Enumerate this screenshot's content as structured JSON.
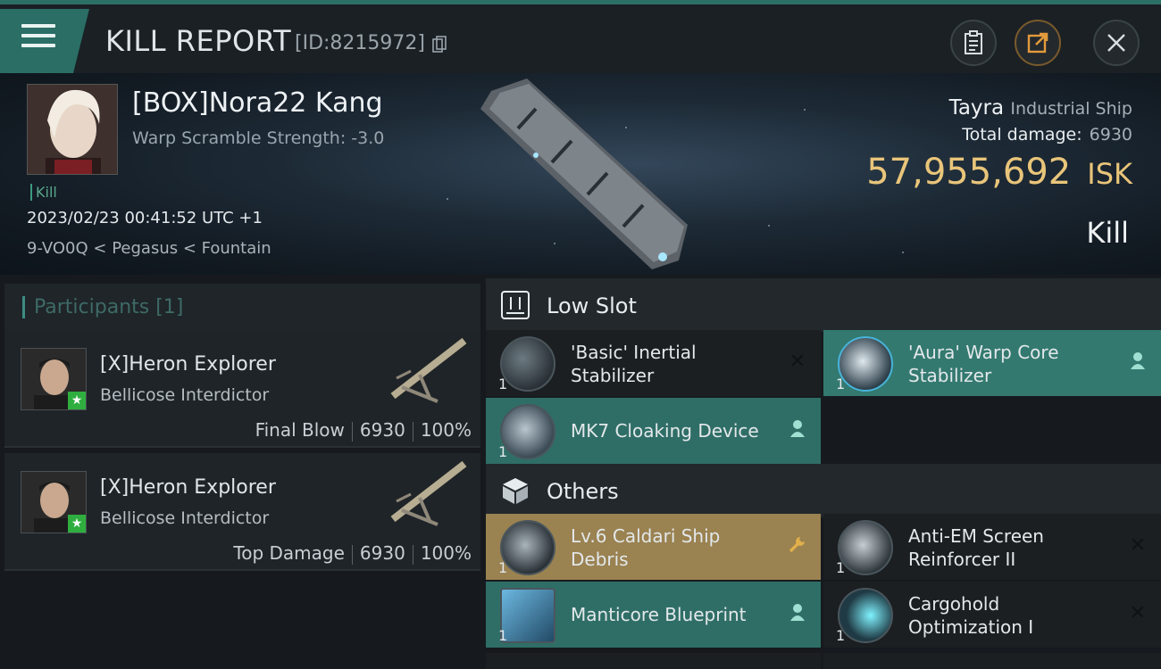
{
  "header": {
    "title": "KILL REPORT",
    "report_id": "[ID:8215972]"
  },
  "victim": {
    "name": "[BOX]Nora22 Kang",
    "warp_scramble": "Warp Scramble Strength: -3.0",
    "tag": "Kill",
    "datetime": "2023/02/23 00:41:52 UTC +1",
    "location": "9-VO0Q < Pegasus < Fountain",
    "ship": "Tayra",
    "ship_class": "Industrial Ship",
    "total_damage_label": "Total damage:",
    "total_damage": "6930",
    "isk_value": "57,955,692",
    "isk_unit": "ISK",
    "result": "Kill"
  },
  "participants": {
    "header": "Participants [1]",
    "items": [
      {
        "name": "[X]Heron Explorer",
        "ship": "Bellicose Interdictor",
        "role": "Final Blow",
        "damage": "6930",
        "percent": "100%"
      },
      {
        "name": "[X]Heron Explorer",
        "ship": "Bellicose Interdictor",
        "role": "Top Damage",
        "damage": "6930",
        "percent": "100%"
      }
    ]
  },
  "sections": {
    "low_slot": "Low Slot",
    "others": "Others"
  },
  "low_slot_items": [
    {
      "name_line1": "'Basic' Inertial",
      "name_line2": "Stabilizer",
      "qty": "1",
      "action": "destroyed"
    },
    {
      "name_line1": "'Aura' Warp Core",
      "name_line2": "Stabilizer",
      "qty": "1",
      "action": "dropped"
    },
    {
      "name": "MK7 Cloaking Device",
      "qty": "1",
      "action": "dropped"
    }
  ],
  "other_items": [
    {
      "name_line1": "Lv.6 Caldari Ship",
      "name_line2": "Debris",
      "qty": "1",
      "action": "wrench"
    },
    {
      "name_line1": "Anti-EM Screen",
      "name_line2": "Reinforcer II",
      "qty": "1",
      "action": "destroyed"
    },
    {
      "name": "Manticore Blueprint",
      "qty": "1",
      "action": "dropped"
    },
    {
      "name_line1": "Cargohold",
      "name_line2": "Optimization I",
      "qty": "1",
      "action": "destroyed"
    }
  ],
  "icons": {
    "close": "✕",
    "destroyed": "✕",
    "person": "👤",
    "wrench": "🔧"
  }
}
